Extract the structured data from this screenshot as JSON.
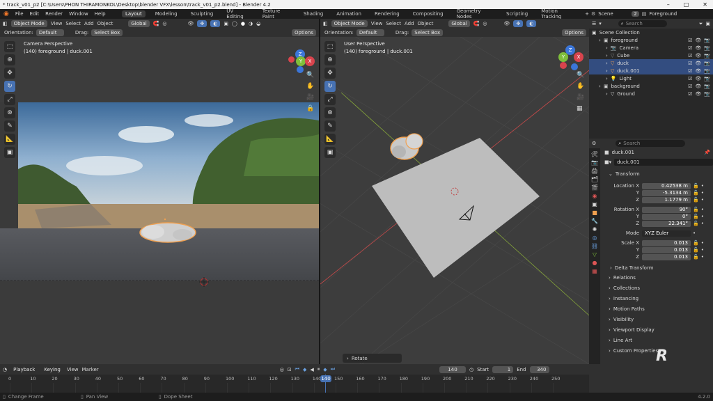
{
  "window": {
    "title": "* track_v01_p2 [C:\\Users\\PHON THIRAMONKOL\\Desktop\\blender VFX\\lesson\\track_v01_p2.blend] - Blender 4.2",
    "min": "–",
    "max": "□",
    "close": "✕"
  },
  "menu": {
    "items": [
      "File",
      "Edit",
      "Render",
      "Window",
      "Help"
    ],
    "workspaces": [
      "Layout",
      "Modeling",
      "Sculpting",
      "UV Editing",
      "Texture Paint",
      "Shading",
      "Animation",
      "Rendering",
      "Compositing",
      "Geometry Nodes",
      "Scripting",
      "Motion Tracking"
    ],
    "active": "Layout",
    "add": "+"
  },
  "top_right": {
    "scene_label": "Scene",
    "scene_count": "2",
    "view_layer": "Foreground"
  },
  "left_vp": {
    "mode": "Object Mode",
    "menus": [
      "View",
      "Select",
      "Add",
      "Object"
    ],
    "orient": "Global",
    "orientation_label": "Orientation:",
    "orientation_value": "Default",
    "drag_label": "Drag:",
    "drag_value": "Select Box",
    "options": "Options",
    "overlay_title": "Camera Perspective",
    "overlay_sub": "(140) foreground | duck.001"
  },
  "right_vp": {
    "mode": "Object Mode",
    "menus": [
      "View",
      "Select",
      "Add",
      "Object"
    ],
    "orient": "Global",
    "orientation_label": "Orientation:",
    "orientation_value": "Default",
    "drag_label": "Drag:",
    "drag_value": "Select Box",
    "options": "Options",
    "overlay_title": "User Perspective",
    "overlay_sub": "(140) foreground | duck.001",
    "operator_panel": "Rotate"
  },
  "gizmo": {
    "x": "X",
    "y": "Y",
    "z": "Z"
  },
  "outliner": {
    "search_placeholder": "Search",
    "root": "Scene Collection",
    "rows": [
      {
        "indent": 1,
        "name": "foreground",
        "icon": "▣",
        "color": "#d0d0d0",
        "sel": false
      },
      {
        "indent": 2,
        "name": "Camera",
        "icon": "📷",
        "color": "#d0d0d0",
        "sel": false
      },
      {
        "indent": 2,
        "name": "Cube",
        "icon": "▽",
        "color": "#888888",
        "sel": false
      },
      {
        "indent": 2,
        "name": "duck",
        "icon": "▽",
        "color": "#f0a050",
        "sel": true
      },
      {
        "indent": 2,
        "name": "duck.001",
        "icon": "▽",
        "color": "#f0a050",
        "sel": true
      },
      {
        "indent": 2,
        "name": "Light",
        "icon": "💡",
        "color": "#d0d0d0",
        "sel": false
      },
      {
        "indent": 1,
        "name": "background",
        "icon": "▣",
        "color": "#d0d0d0",
        "sel": false
      },
      {
        "indent": 2,
        "name": "Ground",
        "icon": "▽",
        "color": "#d0d0d0",
        "sel": false
      }
    ]
  },
  "props": {
    "search_placeholder": "Search",
    "object_name": "duck.001",
    "data_name": "duck.001",
    "transform_label": "Transform",
    "location_label": "Location X",
    "loc": [
      "0.42538 m",
      "-5.3134 m",
      "1.1779 m"
    ],
    "rotation_label": "Rotation X",
    "rot": [
      "90°",
      "0°",
      "22.341°"
    ],
    "mode_label": "Mode",
    "mode": "XYZ Euler",
    "scale_label": "Scale X",
    "scale": [
      "0.013",
      "0.013",
      "0.013"
    ],
    "axis_y": "Y",
    "axis_z": "Z",
    "delta": "Delta Transform",
    "panels": [
      "Relations",
      "Collections",
      "Instancing",
      "Motion Paths",
      "Visibility",
      "Viewport Display",
      "Line Art",
      "Custom Properties"
    ]
  },
  "timeline": {
    "menus": [
      "Playback",
      "Keying",
      "View",
      "Marker"
    ],
    "current": "140",
    "start_label": "Start",
    "start": "1",
    "end_label": "End",
    "end": "340",
    "ticks": [
      "0",
      "10",
      "20",
      "30",
      "40",
      "50",
      "60",
      "70",
      "80",
      "90",
      "100",
      "110",
      "120",
      "130",
      "140",
      "150",
      "160",
      "170",
      "180",
      "190",
      "200",
      "210",
      "220",
      "230",
      "240",
      "250"
    ]
  },
  "status": {
    "a": "Change Frame",
    "b": "Pan View",
    "c": "Dope Sheet",
    "version": "4.2.0"
  },
  "colors": {
    "accent": "#4772b3",
    "selection_outline": "#f0a050",
    "x_axis": "#d9444d",
    "y_axis": "#7fbf3b",
    "z_axis": "#3b76d9"
  }
}
